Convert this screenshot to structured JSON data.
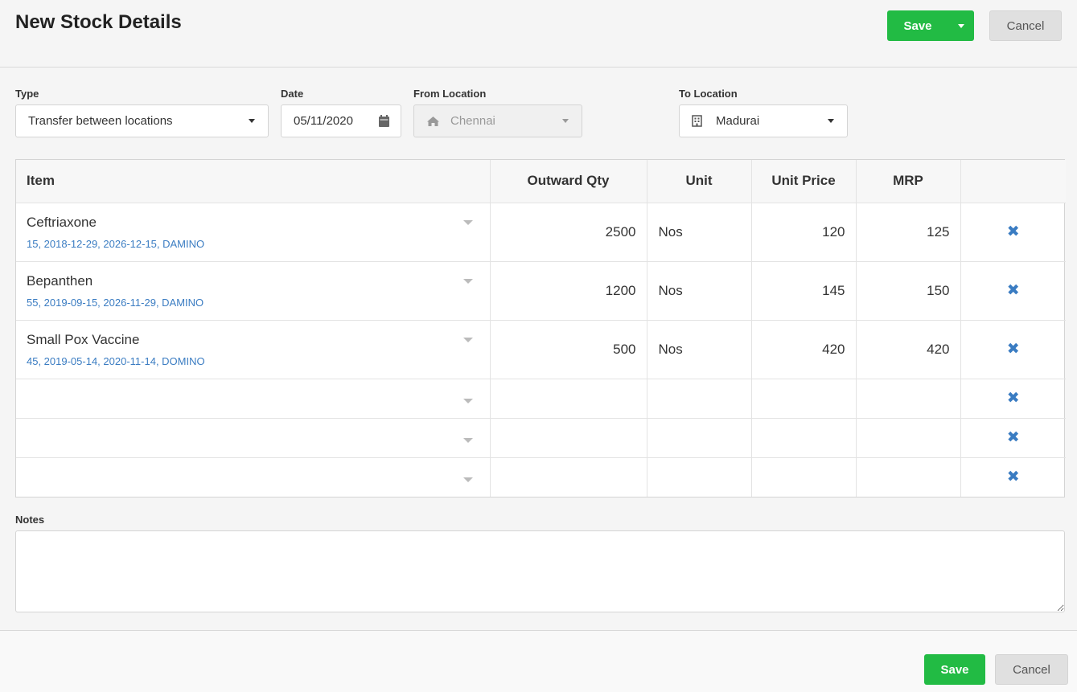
{
  "header": {
    "title": "New Stock Details",
    "save_label": "Save",
    "cancel_label": "Cancel"
  },
  "form": {
    "type_label": "Type",
    "type_value": "Transfer between locations",
    "date_label": "Date",
    "date_value": "05/11/2020",
    "from_label": "From Location",
    "from_value": "Chennai",
    "to_label": "To Location",
    "to_value": "Madurai"
  },
  "table": {
    "columns": [
      "Item",
      "Outward Qty",
      "Unit",
      "Unit Price",
      "MRP",
      ""
    ],
    "rows": [
      {
        "item": "Ceftriaxone",
        "meta": "15, 2018-12-29, 2026-12-15, DAMINO",
        "qty": "2500",
        "unit": "Nos",
        "price": "120",
        "mrp": "125"
      },
      {
        "item": "Bepanthen",
        "meta": "55, 2019-09-15, 2026-11-29, DAMINO",
        "qty": "1200",
        "unit": "Nos",
        "price": "145",
        "mrp": "150"
      },
      {
        "item": "Small Pox Vaccine",
        "meta": "45, 2019-05-14, 2020-11-14, DOMINO",
        "qty": "500",
        "unit": "Nos",
        "price": "420",
        "mrp": "420"
      },
      {
        "item": "",
        "meta": "",
        "qty": "",
        "unit": "",
        "price": "",
        "mrp": ""
      },
      {
        "item": "",
        "meta": "",
        "qty": "",
        "unit": "",
        "price": "",
        "mrp": ""
      },
      {
        "item": "",
        "meta": "",
        "qty": "",
        "unit": "",
        "price": "",
        "mrp": ""
      }
    ],
    "remove_icon": "✖"
  },
  "notes": {
    "label": "Notes",
    "value": ""
  },
  "footer": {
    "save_label": "Save",
    "cancel_label": "Cancel"
  },
  "colors": {
    "primary_green": "#22bb44",
    "link_blue": "#3a7cc2"
  }
}
